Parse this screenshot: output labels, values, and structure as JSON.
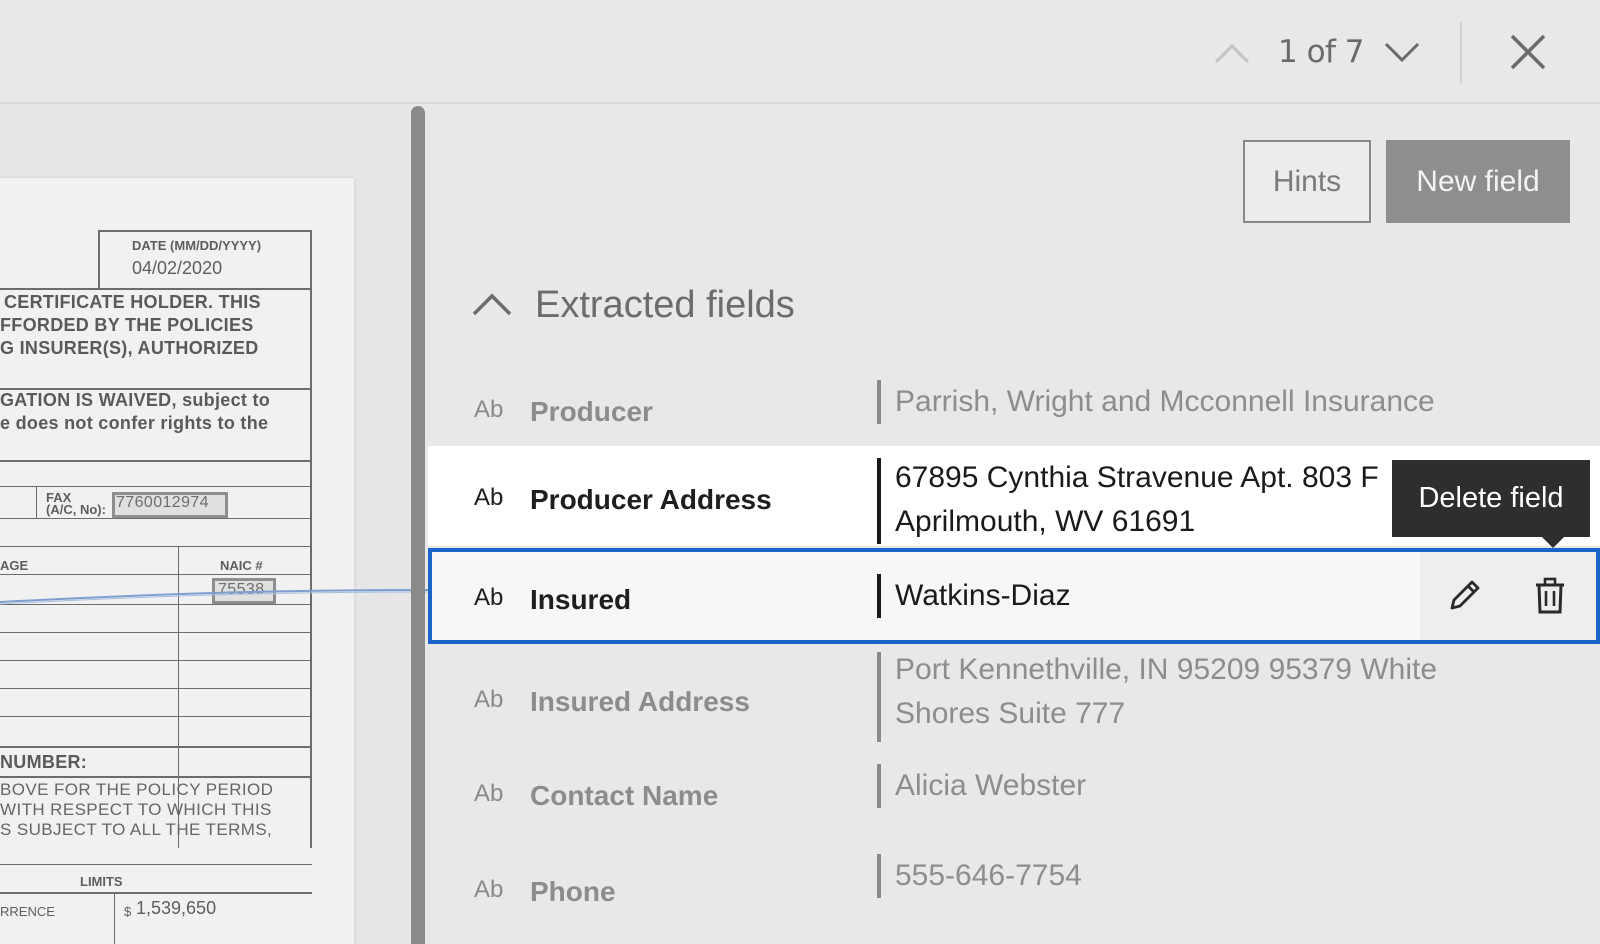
{
  "pager": {
    "text": "1 of 7"
  },
  "toolbar": {
    "hints_label": "Hints",
    "new_field_label": "New field"
  },
  "section": {
    "title": "Extracted fields"
  },
  "tooltip": {
    "text": "Delete field"
  },
  "document": {
    "date_label": "DATE (MM/DD/YYYY)",
    "date_value": "04/02/2020",
    "lines": [
      "CERTIFICATE HOLDER. THIS",
      "FFORDED BY THE POLICIES",
      "G INSURER(S), AUTHORIZED",
      "GATION IS WAIVED, subject to",
      "e does not confer rights to the",
      "NUMBER:",
      "BOVE FOR THE POLICY PERIOD",
      "WITH RESPECT TO WHICH THIS",
      "S SUBJECT TO ALL THE TERMS,"
    ],
    "fax_label": "FAX",
    "fax_sub": "(A/C, No):",
    "fax_value": "7760012974",
    "age_label": "AGE",
    "naic_label": "NAIC #",
    "naic_value": "75538",
    "limits_label": "LIMITS",
    "rrence_label": "RRENCE",
    "currency": "$",
    "limit_value": "1,539,650"
  },
  "fields": [
    {
      "type": "Ab",
      "label": "Producer",
      "value_lines": [
        "Parrish, Wright and Mcconnell Insurance"
      ]
    },
    {
      "type": "Ab",
      "label": "Producer Address",
      "value_lines": [
        "67895 Cynthia Stravenue Apt. 803 F",
        "Aprilmouth, WV 61691"
      ]
    },
    {
      "type": "Ab",
      "label": "Insured",
      "value_lines": [
        "Watkins-Diaz"
      ]
    },
    {
      "type": "Ab",
      "label": "Insured Address",
      "value_lines": [
        "Port Kennethville, IN 95209 95379 White",
        "Shores Suite 777"
      ]
    },
    {
      "type": "Ab",
      "label": "Contact Name",
      "value_lines": [
        "Alicia Webster"
      ]
    },
    {
      "type": "Ab",
      "label": "Phone",
      "value_lines": [
        "555-646-7754"
      ]
    }
  ],
  "colors": {
    "selection": "#1a63c7",
    "tooltip_bg": "#2e2e2e",
    "button_primary": "#8e8e8e"
  },
  "icons": [
    "chevron-up-icon",
    "chevron-down-icon",
    "close-icon",
    "collapse-chevron-icon",
    "pencil-icon",
    "trash-icon"
  ]
}
